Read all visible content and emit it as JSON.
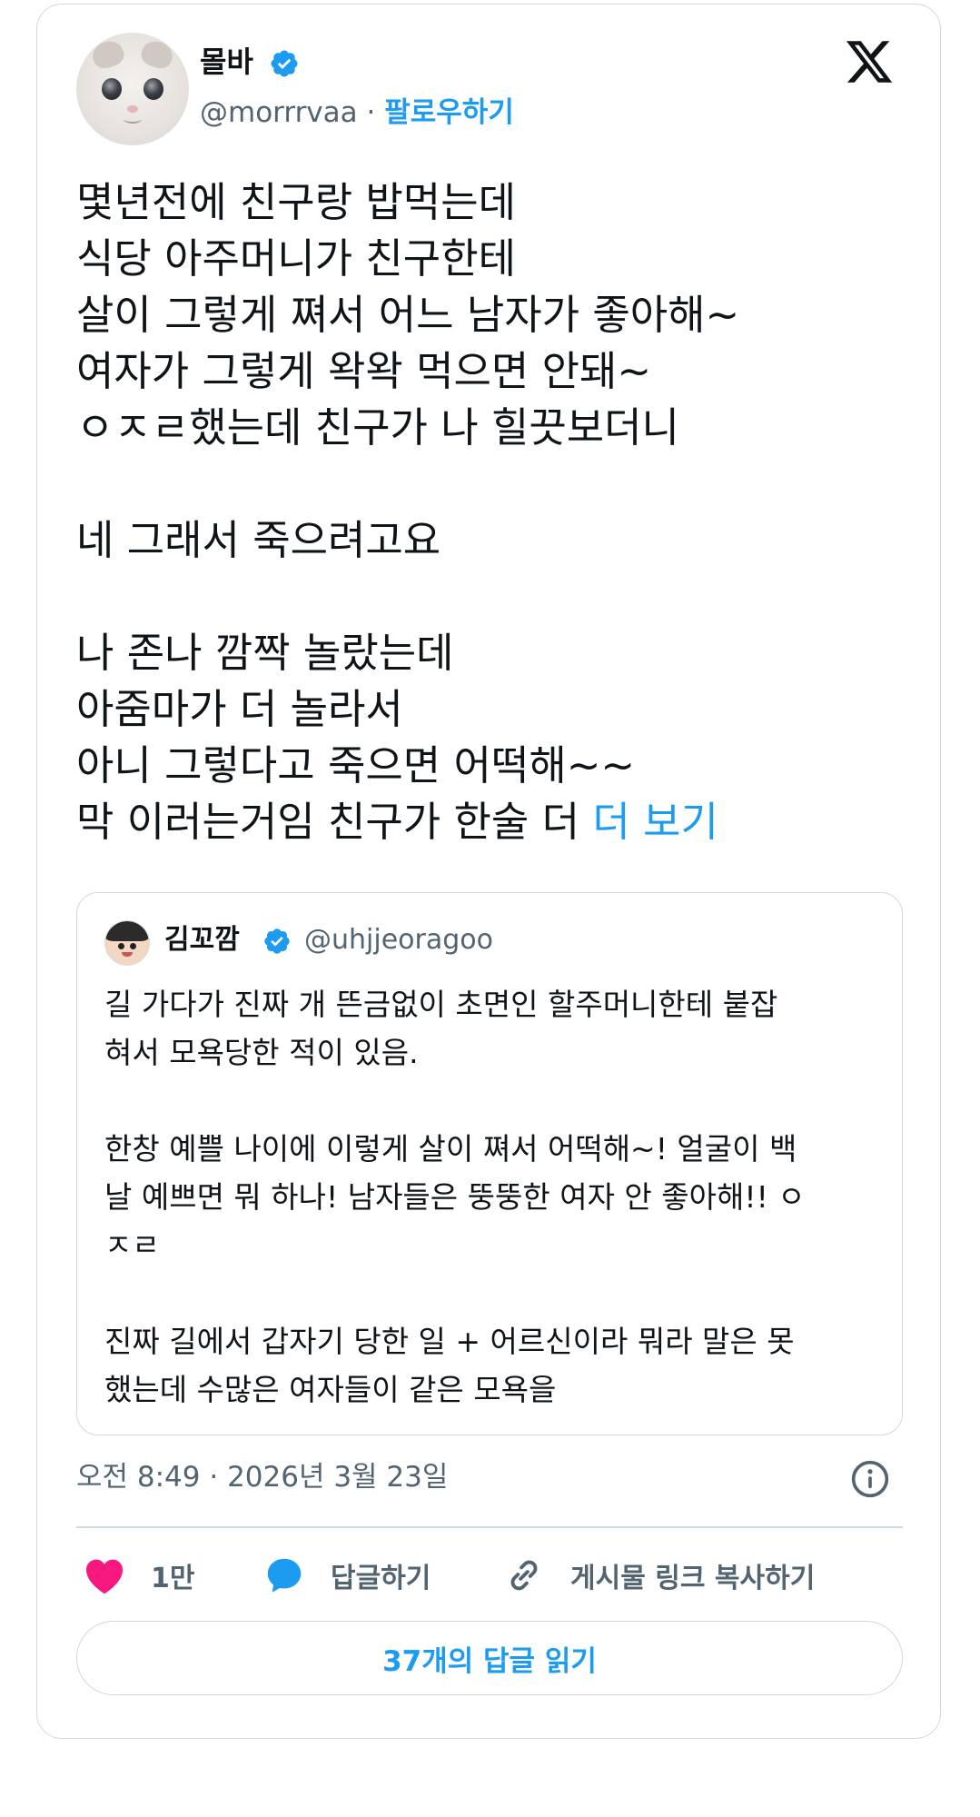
{
  "author": {
    "name": "몰바",
    "handle": "@morrrvaa",
    "separator": "·",
    "follow_label": "팔로우하기",
    "verified": true,
    "avatar_icon": "cat-avatar"
  },
  "platform_icon": "x-logo-icon",
  "tweet": {
    "lines": [
      "몇년전에 친구랑 밥먹는데",
      "식당 아주머니가 친구한테",
      "살이 그렇게 쪄서 어느 남자가 좋아해~",
      "여자가 그렇게 왁왁 먹으면 안돼~",
      "ㅇㅈㄹ했는데 친구가 나 힐끗보더니",
      "",
      "네 그래서 죽으려고요",
      "",
      "나 존나 깜짝 놀랐는데",
      "아줌마가 더 놀라서",
      "아니 그렇다고 죽으면 어떡해~~",
      "막 이러는거임 친구가 한술 더"
    ],
    "more_label": "더 보기"
  },
  "quote": {
    "name": "김꼬깜",
    "handle": "@uhjjeoragoo",
    "verified": true,
    "lines": [
      "길 가다가 진짜 개 뜬금없이 초면인 할주머니한테 붙잡",
      "혀서 모욕당한 적이 있음.",
      "",
      "한창 예쁠 나이에 이렇게 살이 쪄서 어떡해~! 얼굴이 백",
      "날 예쁘면 뭐 하나! 남자들은 뚱뚱한 여자 안 좋아해!! ㅇ",
      "ㅈㄹ",
      "",
      "진짜 길에서 갑자기 당한 일 + 어르신이라 뭐라 말은 못",
      "했는데 수많은 여자들이 같은 모욕을"
    ]
  },
  "timestamp": "오전 8:49 · 2026년 3월 23일",
  "actions": {
    "like_count": "1만",
    "reply_label": "답글하기",
    "copy_label": "게시물 링크 복사하기"
  },
  "read_replies_label": "37개의 답글 읽기",
  "colors": {
    "accent": "#1d9bf0",
    "like": "#f91880",
    "text": "#0f1419",
    "secondary": "#536471",
    "border": "#cfd9de"
  }
}
